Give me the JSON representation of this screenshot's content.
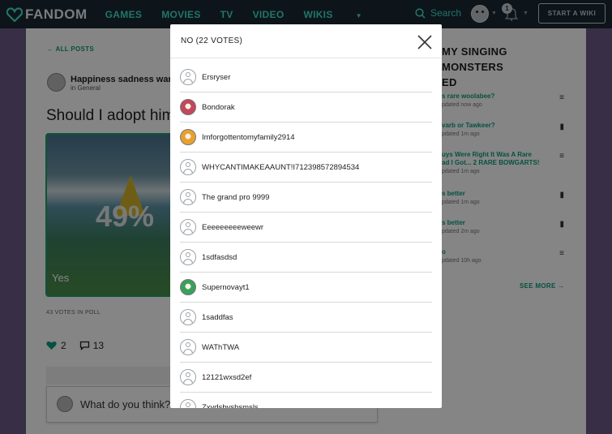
{
  "nav": {
    "logo": "FANDOM",
    "links": [
      "GAMES",
      "MOVIES",
      "TV",
      "VIDEO",
      "WIKIS"
    ],
    "search_label": "Search",
    "notification_count": "1",
    "start_wiki": "START A WIKI"
  },
  "post": {
    "all_posts": "ALL POSTS",
    "author": "Happiness sadness war",
    "category": "in General",
    "title": "Should I adopt him",
    "poll_percent": "49%",
    "poll_answer": "Yes",
    "votes_in_poll": "43 VOTES IN POLL",
    "likes": "2",
    "comments": "13",
    "reply_placeholder": "What do you think?"
  },
  "sidebar": {
    "title": "MY SINGING MONSTERS\nED",
    "items": [
      {
        "title": "s rare woolabee?",
        "updated": "pdated now ago",
        "icon": "list-icon"
      },
      {
        "title": "varb or Tawkeer?",
        "updated": "pdated 1m ago",
        "icon": "poll-icon"
      },
      {
        "title": "uys Were Right It Was A Rare\nad I Got... 2 RARE BOWGARTS!",
        "updated": "pdated 1m ago",
        "icon": "list-icon"
      },
      {
        "title": "s better",
        "updated": "pdated 1m ago",
        "icon": "poll-icon"
      },
      {
        "title": "s better",
        "updated": "pdated 2m ago",
        "icon": "poll-icon"
      },
      {
        "title": "o",
        "updated": "pdated 10h ago",
        "icon": "list-icon"
      }
    ],
    "see_more": "SEE MORE"
  },
  "modal": {
    "title": "NO (22 VOTES)",
    "voters": [
      {
        "name": "Ersryser",
        "avatar": "default"
      },
      {
        "name": "Bondorak",
        "avatar": "photo",
        "color": "#c4475a"
      },
      {
        "name": "Imforgottentomyfamily2914",
        "avatar": "photo",
        "color": "#e8a030"
      },
      {
        "name": "WHYCANTIMAKEAAUNT!I712398572894534",
        "avatar": "default"
      },
      {
        "name": "The grand pro 9999",
        "avatar": "default"
      },
      {
        "name": "Eeeeeeeeeweewr",
        "avatar": "default"
      },
      {
        "name": "1sdfasdsd",
        "avatar": "default"
      },
      {
        "name": "Supernovayt1",
        "avatar": "photo",
        "color": "#3aa05a"
      },
      {
        "name": "1saddfas",
        "avatar": "default"
      },
      {
        "name": "WAThTWA",
        "avatar": "default"
      },
      {
        "name": "12121wxsd2ef",
        "avatar": "default"
      },
      {
        "name": "Zxvdsbvshsmsls",
        "avatar": "default"
      }
    ]
  }
}
